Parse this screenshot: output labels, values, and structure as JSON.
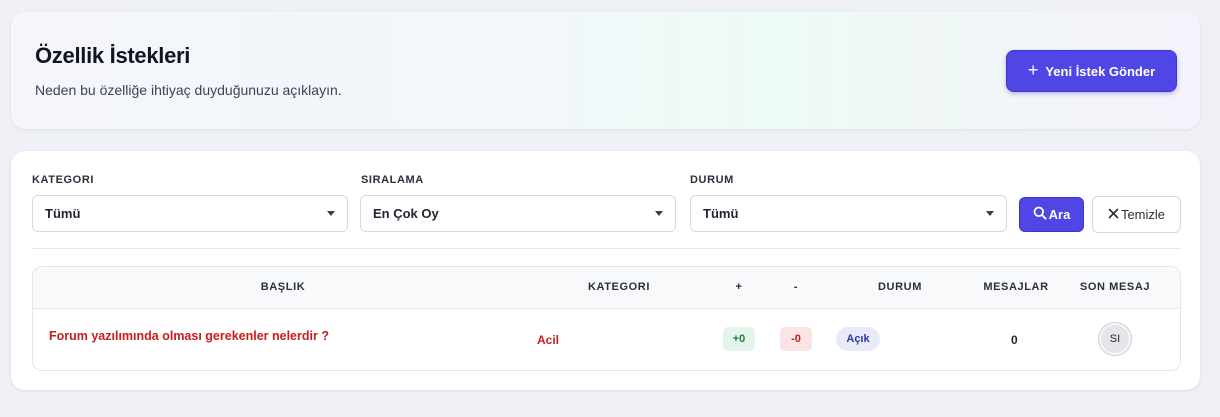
{
  "header": {
    "title": "Özellik İstekleri",
    "subtitle": "Neden bu özelliğe ihtiyaç duyduğunuzu açıklayın.",
    "new_request_label": "Yeni İstek Gönder",
    "new_request_icon": "plus-icon"
  },
  "filters": {
    "category_label": "KATEGORI",
    "category_value": "Tümü",
    "sort_label": "SIRALAMA",
    "sort_value": "En Çok Oy",
    "status_label": "DURUM",
    "status_value": "Tümü",
    "search_label": "Ara",
    "search_icon": "search-icon",
    "clear_label": "Temizle",
    "clear_icon": "close-icon"
  },
  "table": {
    "columns": [
      "BAŞLIK",
      "KATEGORI",
      "+",
      "-",
      "DURUM",
      "MESAJLAR",
      "SON MESAJ"
    ],
    "rows": [
      {
        "title": "Forum yazılımında olması gerekenler nelerdir ?",
        "category": "Acil",
        "plus": "+0",
        "minus": "-0",
        "status": "Açık",
        "messages": "0",
        "last_message_avatar": "SI"
      }
    ]
  },
  "colors": {
    "accent": "#4f46e5",
    "danger": "#c81e1e",
    "success": "#1e7a3e"
  }
}
